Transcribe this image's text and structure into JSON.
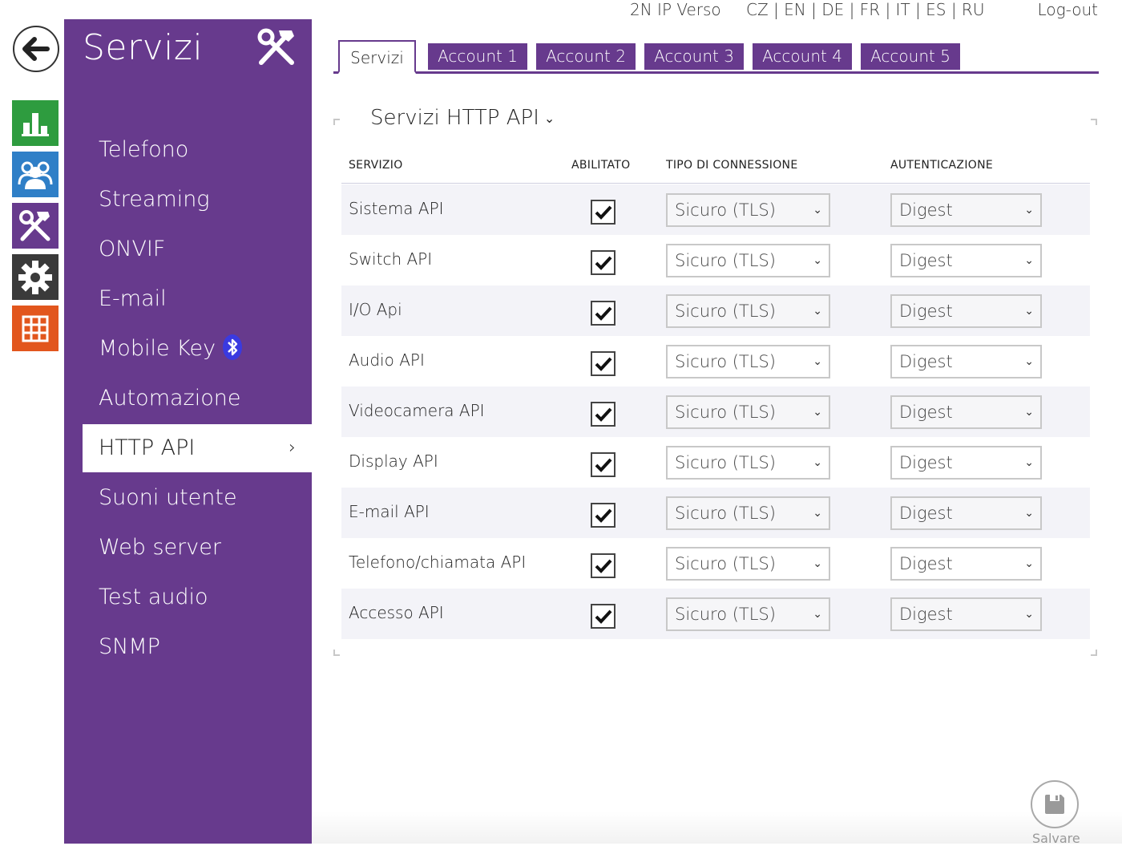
{
  "header": {
    "device_name": "2N IP Verso",
    "languages": [
      "CZ",
      "EN",
      "DE",
      "FR",
      "IT",
      "ES",
      "RU"
    ],
    "logout_label": "Log-out"
  },
  "rail": {
    "items": [
      {
        "icon": "status-chart-icon",
        "color": "#2e9c3f"
      },
      {
        "icon": "directory-users-icon",
        "color": "#2f7fc7"
      },
      {
        "icon": "services-tools-icon",
        "color": "#673a8d"
      },
      {
        "icon": "hardware-gear-icon",
        "color": "#3a3a3a"
      },
      {
        "icon": "system-grid-icon",
        "color": "#e2561d"
      }
    ]
  },
  "sidebar": {
    "title": "Servizi",
    "items": [
      {
        "label": "Telefono"
      },
      {
        "label": "Streaming"
      },
      {
        "label": "ONVIF"
      },
      {
        "label": "E-mail"
      },
      {
        "label": "Mobile Key"
      },
      {
        "label": "Automazione"
      },
      {
        "label": "HTTP API"
      },
      {
        "label": "Suoni utente"
      },
      {
        "label": "Web server"
      },
      {
        "label": "Test audio"
      },
      {
        "label": "SNMP"
      }
    ],
    "active": "HTTP API"
  },
  "tabs": [
    {
      "label": "Servizi"
    },
    {
      "label": "Account 1"
    },
    {
      "label": "Account 2"
    },
    {
      "label": "Account 3"
    },
    {
      "label": "Account 4"
    },
    {
      "label": "Account 5"
    }
  ],
  "panel": {
    "title": "Servizi HTTP API",
    "columns": {
      "service": "SERVIZIO",
      "enabled": "ABILITATO",
      "connection": "TIPO DI CONNESSIONE",
      "auth": "AUTENTICAZIONE"
    },
    "rows": [
      {
        "service": "Sistema API",
        "enabled": true,
        "connection": "Sicuro (TLS)",
        "auth": "Digest"
      },
      {
        "service": "Switch API",
        "enabled": true,
        "connection": "Sicuro (TLS)",
        "auth": "Digest"
      },
      {
        "service": "I/O Api",
        "enabled": true,
        "connection": "Sicuro (TLS)",
        "auth": "Digest"
      },
      {
        "service": "Audio API",
        "enabled": true,
        "connection": "Sicuro (TLS)",
        "auth": "Digest"
      },
      {
        "service": "Videocamera API",
        "enabled": true,
        "connection": "Sicuro (TLS)",
        "auth": "Digest"
      },
      {
        "service": "Display API",
        "enabled": true,
        "connection": "Sicuro (TLS)",
        "auth": "Digest"
      },
      {
        "service": "E-mail API",
        "enabled": true,
        "connection": "Sicuro (TLS)",
        "auth": "Digest"
      },
      {
        "service": "Telefono/chiamata API",
        "enabled": true,
        "connection": "Sicuro (TLS)",
        "auth": "Digest"
      },
      {
        "service": "Accesso API",
        "enabled": true,
        "connection": "Sicuro (TLS)",
        "auth": "Digest"
      }
    ]
  },
  "save": {
    "label": "Salvare"
  },
  "colors": {
    "accent": "#673a8d"
  }
}
